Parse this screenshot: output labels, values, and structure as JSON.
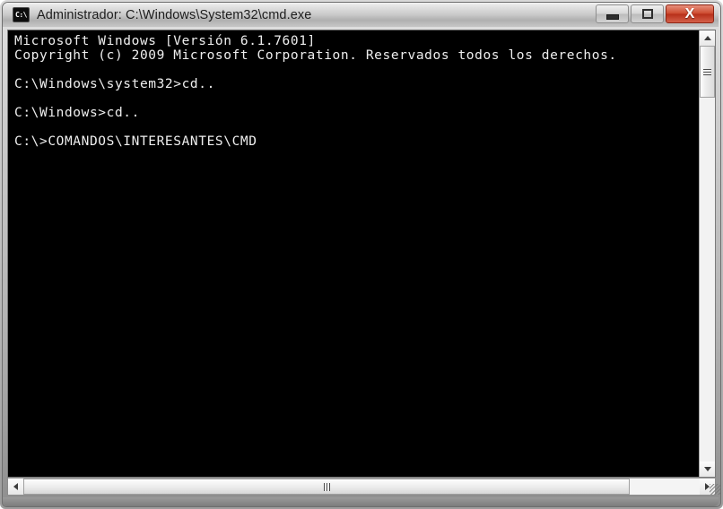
{
  "window": {
    "title": "Administrador: C:\\Windows\\System32\\cmd.exe",
    "icon_name": "cmd-icon",
    "icon_label": "C:\\",
    "controls": {
      "minimize_label": "–",
      "maximize_label": "□",
      "close_label": "X"
    }
  },
  "console": {
    "background_color": "#000000",
    "text_color": "#eeeeee",
    "lines": [
      "Microsoft Windows [Versión 6.1.7601]",
      "Copyright (c) 2009 Microsoft Corporation. Reservados todos los derechos.",
      "",
      "C:\\Windows\\system32>cd..",
      "",
      "C:\\Windows>cd..",
      "",
      "C:\\>COMANDOS\\INTERESANTES\\CMD"
    ]
  },
  "scrollbars": {
    "vertical": {
      "up_arrow": "▲",
      "down_arrow": "▼",
      "thumb_grip": "grip"
    },
    "horizontal": {
      "left_arrow": "◀",
      "right_arrow": "▶",
      "thumb_grip": "grip"
    }
  },
  "colors": {
    "titlebar_text": "#1d1d1d",
    "close_button": "#b8301a",
    "frame": "#b4b4b4",
    "scroll_track": "#f0f0f0"
  }
}
